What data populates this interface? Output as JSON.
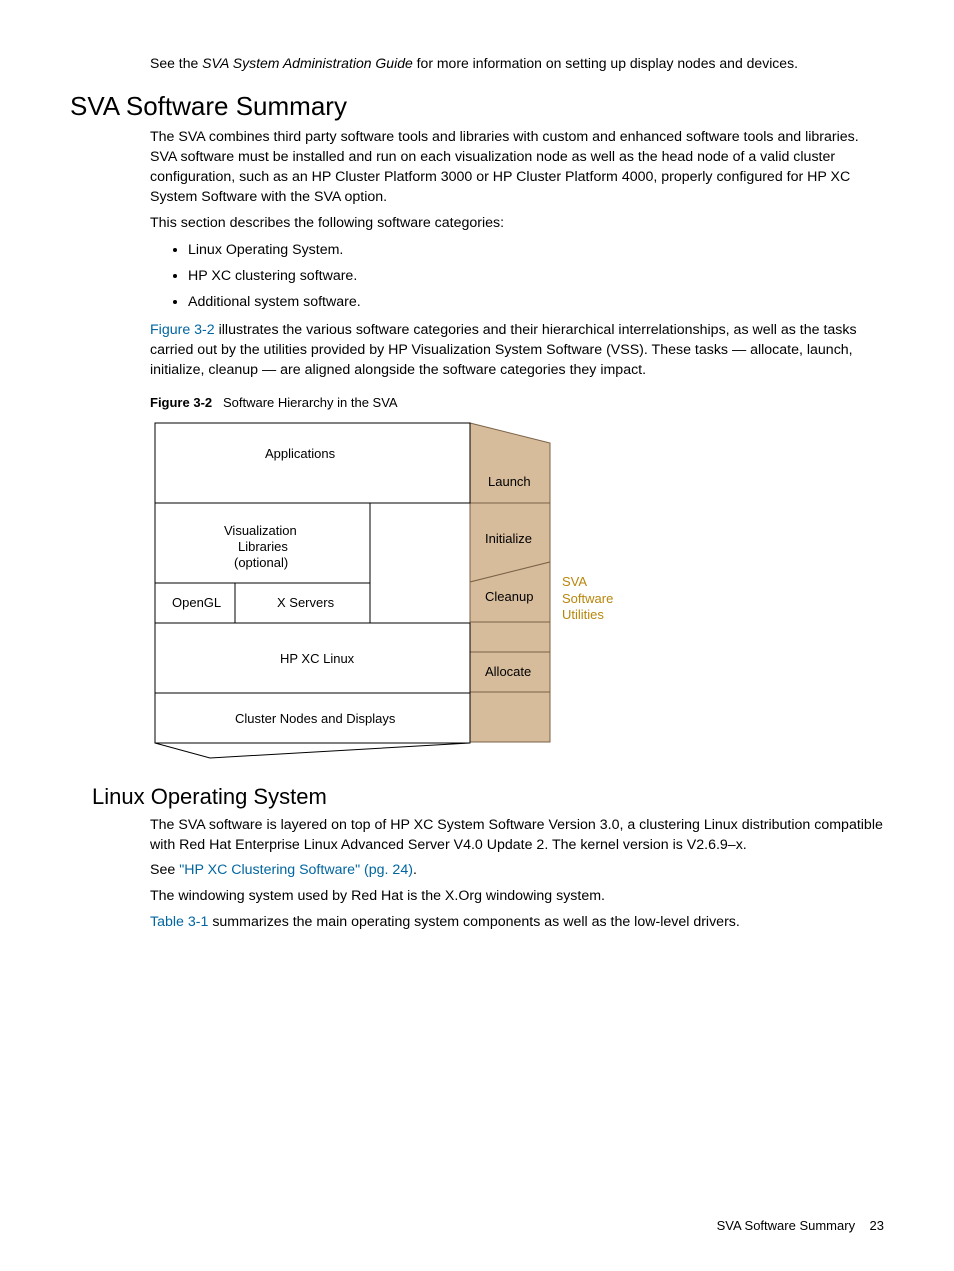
{
  "intro": {
    "pre": "See the ",
    "title": "SVA System Administration Guide",
    "post": " for more information on setting up display nodes and devices."
  },
  "h1": "SVA Software Summary",
  "p1": "The SVA combines third party software tools and libraries with custom and enhanced software tools and libraries. SVA software must be installed and run on each visualization node as well as the head node of a valid cluster configuration, such as an HP Cluster Platform 3000 or HP Cluster Platform 4000, properly configured for HP XC System Software with the SVA option.",
  "p2": "This section describes the following software categories:",
  "bullets": {
    "b0": "Linux Operating System.",
    "b1": "HP XC clustering software.",
    "b2": "Additional system software."
  },
  "p3": {
    "link": "Figure  3-2",
    "rest": " illustrates the various software categories and their hierarchical interrelationships, as well as the tasks carried out by the utilities provided by HP Visualization System Software (VSS). These tasks — allocate, launch, initialize, cleanup — are aligned alongside the software categories they impact."
  },
  "figcap": {
    "bold": "Figure  3-2",
    "rest": "Software Hierarchy in the SVA"
  },
  "diagram": {
    "applications": "Applications",
    "vizlib1": "Visualization",
    "vizlib2": "Libraries",
    "vizlib3": "(optional)",
    "opengl": "OpenGL",
    "xservers": "X Servers",
    "hpxc": "HP XC Linux",
    "cluster": "Cluster Nodes and Displays",
    "launch": "Launch",
    "initialize": "Initialize",
    "cleanup": "Cleanup",
    "allocate": "Allocate",
    "sva_label": "SVA\nSoftware\nUtilities"
  },
  "h2": "Linux Operating System",
  "p4": "The SVA software is layered on top of HP XC System Software Version 3.0, a clustering Linux distribution compatible with Red Hat Enterprise Linux Advanced Server V4.0 Update 2. The kernel version is V2.6.9–x.",
  "p5": {
    "pre": "See ",
    "link": "\"HP XC Clustering Software\" (pg. 24)",
    "post": "."
  },
  "p6": "The windowing system used by Red Hat is the X.Org windowing system.",
  "p7": {
    "link": "Table  3-1",
    "rest": " summarizes the main operating system components as well as the low-level drivers."
  },
  "footer": {
    "title": "SVA Software Summary",
    "page": "23"
  }
}
